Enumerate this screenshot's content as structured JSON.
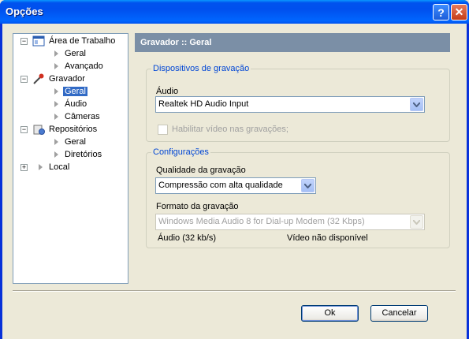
{
  "window": {
    "title": "Opções"
  },
  "tree": {
    "items": [
      {
        "label": "Área de Trabalho"
      },
      {
        "label": "Geral"
      },
      {
        "label": "Avançado"
      },
      {
        "label": "Gravador"
      },
      {
        "label": "Geral"
      },
      {
        "label": "Áudio"
      },
      {
        "label": "Câmeras"
      },
      {
        "label": "Repositórios"
      },
      {
        "label": "Geral"
      },
      {
        "label": "Diretórios"
      },
      {
        "label": "Local"
      }
    ]
  },
  "panel": {
    "header": "Gravador :: Geral",
    "devices_group": {
      "title": "Dispositivos de gravação",
      "audio_label": "Áudio",
      "audio_value": "Realtek HD Audio Input",
      "video_checkbox_label": "Habilitar vídeo nas gravações;"
    },
    "config_group": {
      "title": "Configurações",
      "quality_label": "Qualidade da gravação",
      "quality_value": "Compressão com alta qualidade",
      "format_label": "Formato da gravação",
      "format_value": "Windows Media Audio 8 for Dial-up Modem (32 Kbps)",
      "audio_info": "Áudio (32 kb/s)",
      "video_info": "Vídeo não disponível"
    }
  },
  "buttons": {
    "ok": "Ok",
    "cancel": "Cancelar"
  }
}
